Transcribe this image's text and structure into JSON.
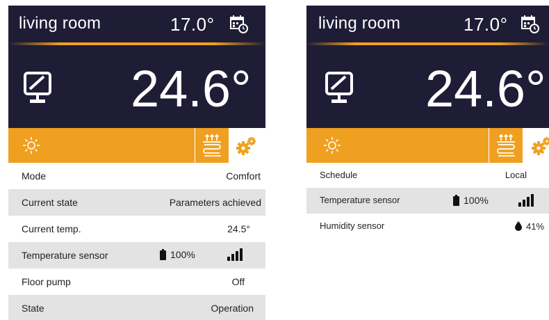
{
  "colors": {
    "header_bg": "#1f1d36",
    "accent": "#f0a020",
    "row_shade": "#e3e3e3"
  },
  "left_panel": {
    "room_name": "living room",
    "setpoint": "17.0°",
    "current_temperature": "24.6°",
    "icons": [
      "calendar-clock-icon",
      "display-icon",
      "sun-icon",
      "floor-heating-icon",
      "gears-icon"
    ],
    "rows": [
      {
        "label": "Mode",
        "value": "Comfort"
      },
      {
        "label": "Current state",
        "value": "Parameters achieved"
      },
      {
        "label": "Current temp.",
        "value": "24.5°"
      },
      {
        "label": "Temperature sensor",
        "battery": "100%",
        "signal": "signal-strength-icon"
      },
      {
        "label": "Floor pump",
        "value": "Off"
      },
      {
        "label": "State",
        "value": "Operation"
      }
    ]
  },
  "right_panel": {
    "room_name": "living room",
    "setpoint": "17.0°",
    "current_temperature": "24.6°",
    "rows": [
      {
        "label": "Schedule",
        "value": "Local"
      },
      {
        "label": "Temperature sensor",
        "battery": "100%",
        "signal": "signal-strength-icon"
      },
      {
        "label": "Humidity sensor",
        "humidity": "41%"
      }
    ]
  }
}
